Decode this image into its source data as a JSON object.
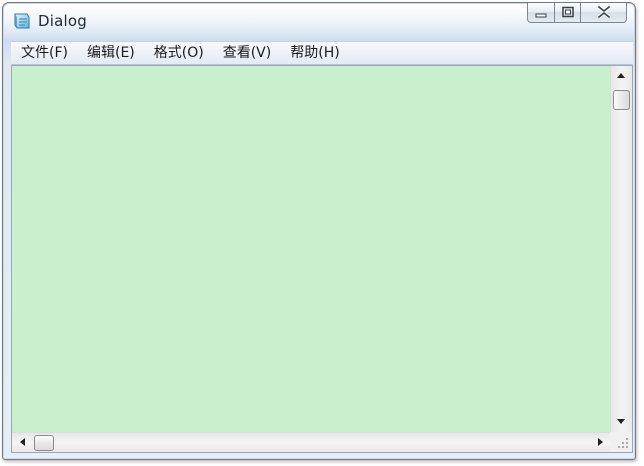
{
  "window": {
    "title": "Dialog",
    "icon": "notepad-icon"
  },
  "caption": {
    "minimize_icon": "minimize-icon",
    "maximize_icon": "maximize-icon",
    "close_icon": "close-icon"
  },
  "menu": {
    "items": [
      {
        "label": "文件(F)"
      },
      {
        "label": "编辑(E)"
      },
      {
        "label": "格式(O)"
      },
      {
        "label": "查看(V)"
      },
      {
        "label": "帮助(H)"
      }
    ]
  },
  "editor": {
    "content": "",
    "background": "#c8f0cc"
  },
  "scrollbars": {
    "up_icon": "arrow-up-icon",
    "down_icon": "arrow-down-icon",
    "left_icon": "arrow-left-icon",
    "right_icon": "arrow-right-icon"
  }
}
